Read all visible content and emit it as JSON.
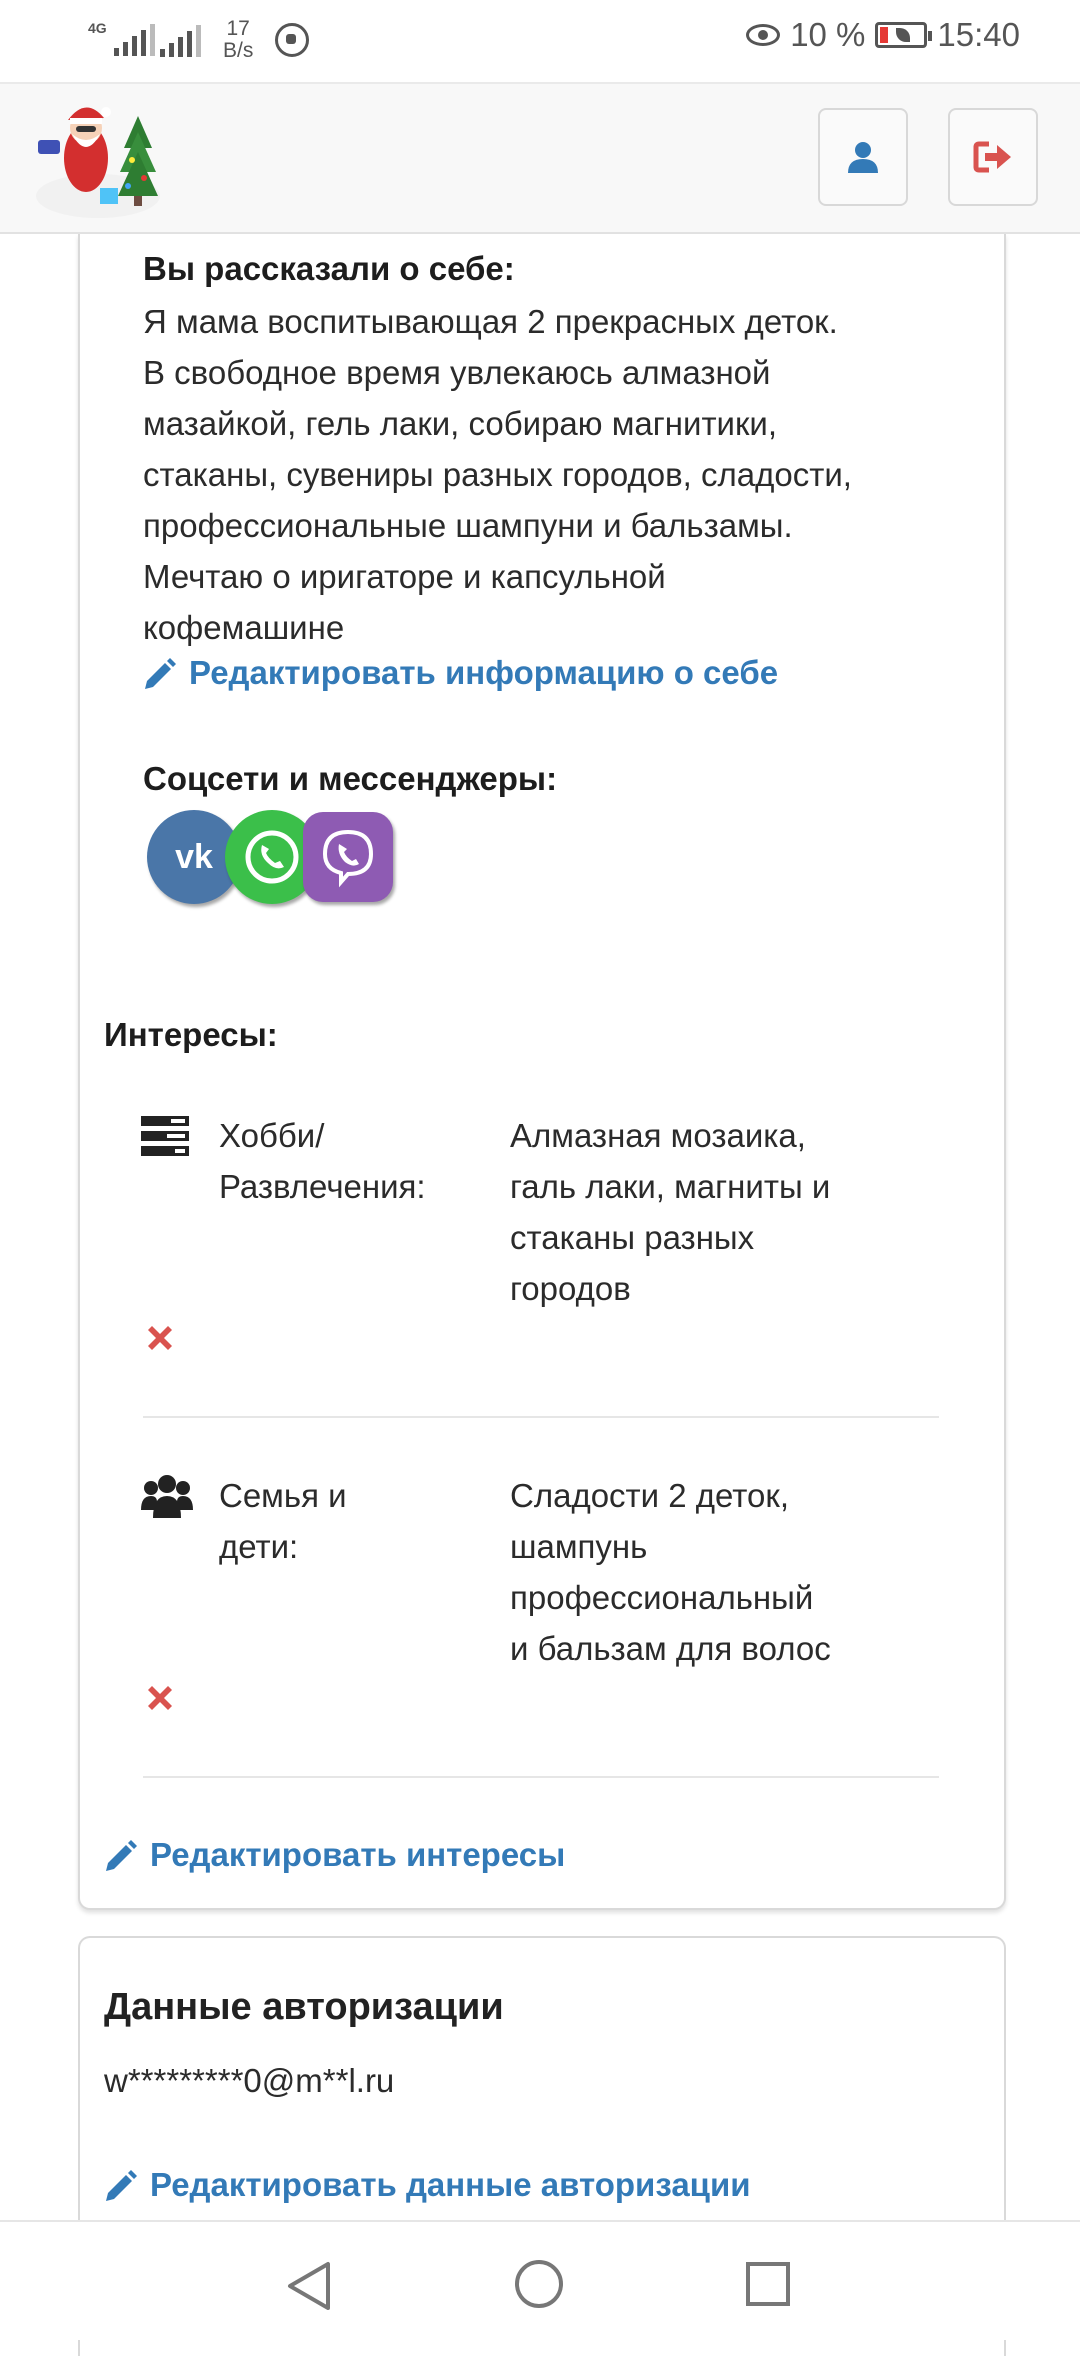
{
  "status_bar": {
    "network": "4G",
    "speed_value": "17",
    "speed_unit": "B/s",
    "battery_percent": "10 %",
    "time": "15:40"
  },
  "header": {
    "user_icon": "user-icon",
    "logout_icon": "sign-out-icon"
  },
  "about": {
    "title": "Вы рассказали о себе:",
    "lines": [
      "Я мама воспитывающая 2 прекрасных деток.",
      "В свободное время увлекаюсь алмазной",
      "мазайкой, гель лаки, собираю магнитики,",
      "стаканы, сувениры разных городов, сладости,",
      "профессиональные шампуни и бальзамы.",
      "Мечтаю о иригаторе и капсульной",
      "кофемашине"
    ],
    "edit_link": "Редактировать информацию о себе"
  },
  "social": {
    "title": "Соцсети и мессенджеры:",
    "icons": [
      "vk-icon",
      "whatsapp-icon",
      "viber-icon"
    ],
    "vk_text": "vk"
  },
  "interests": {
    "title": "Интересы:",
    "items": [
      {
        "icon": "tasks-icon",
        "label_lines": [
          "Хобби/",
          "Развлечения:"
        ],
        "value_lines": [
          "Алмазная мозаика,",
          "галь лаки, магниты и",
          "стаканы разных",
          "городов"
        ]
      },
      {
        "icon": "users-icon",
        "label_lines": [
          "Семья и",
          "дети:"
        ],
        "value_lines": [
          "Сладости 2 деток,",
          "шампунь",
          "профессиональный",
          "и бальзам для волос"
        ]
      }
    ],
    "edit_link": "Редактировать интересы"
  },
  "auth": {
    "title": "Данные авторизации",
    "email": "w*********0@m**l.ru",
    "edit_link": "Редактировать данные авторизации"
  },
  "colors": {
    "link": "#337ab7",
    "delete": "#d9534f",
    "vk": "#4a76a8",
    "whatsapp": "#3bbf4a",
    "viber": "#8e5bb3"
  }
}
